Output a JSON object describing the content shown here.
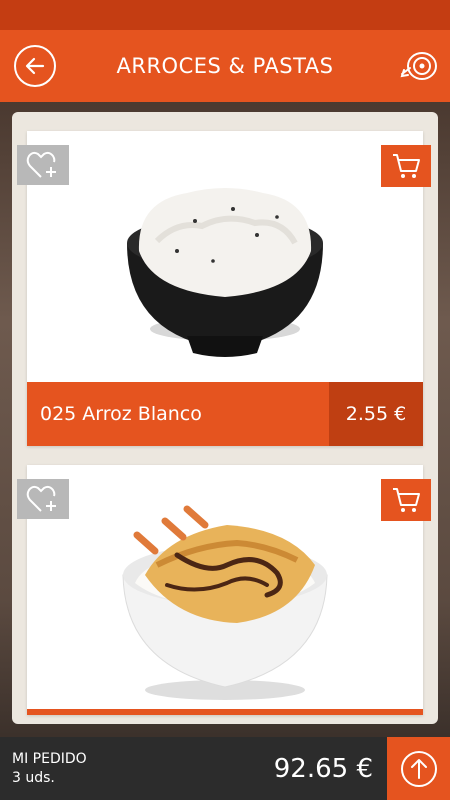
{
  "app_bar": {
    "title": "ARROCES & PASTAS",
    "back_icon": "back-arrow-circle-icon",
    "profile_icon": "meat-icon"
  },
  "colors": {
    "accent": "#e5541f",
    "accent_dark": "#bf3f12",
    "status_bar": "#c43d12",
    "bottom_bar": "#2c2c2c",
    "fav_button": "#b8b8b8"
  },
  "products": [
    {
      "name": "025 Arroz Blanco",
      "price": "2.55 €",
      "fav_icon": "heart-plus-icon",
      "cart_icon": "shopping-cart-icon"
    },
    {
      "fav_icon": "heart-plus-icon",
      "cart_icon": "shopping-cart-icon"
    }
  ],
  "order": {
    "label": "MI PEDIDO",
    "count": "3 uds.",
    "total": "92.65 €",
    "open_icon": "arrow-up-circle-icon"
  }
}
